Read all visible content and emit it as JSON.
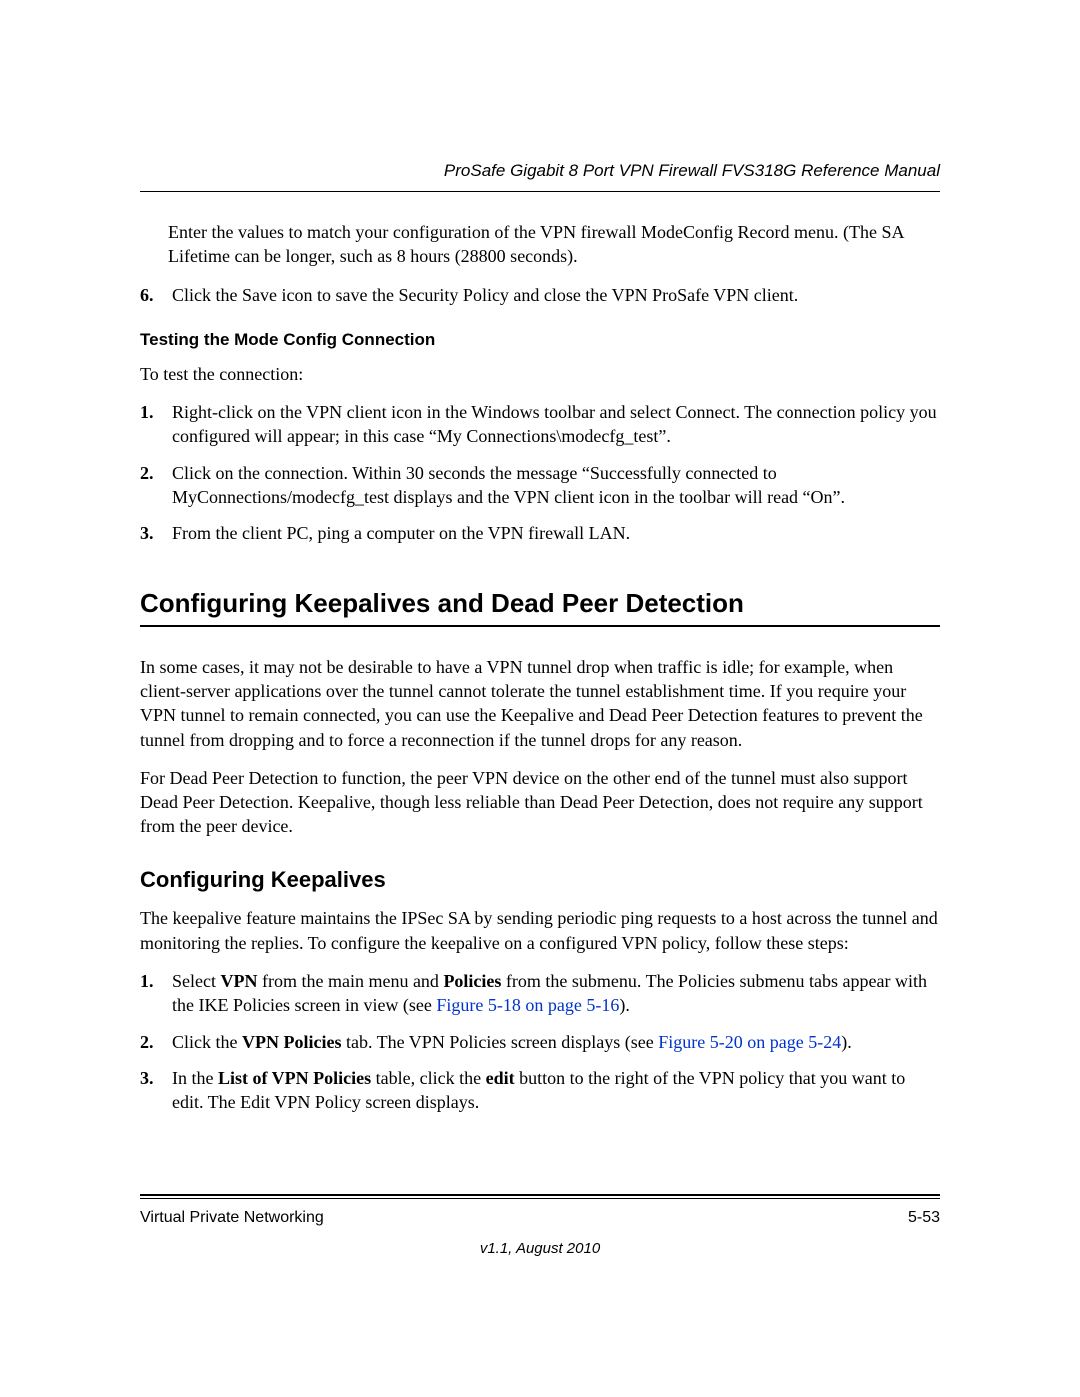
{
  "header": {
    "running_title": "ProSafe Gigabit 8 Port VPN Firewall FVS318G Reference Manual"
  },
  "intro_block": {
    "para": "Enter the values to match your configuration of the VPN firewall ModeConfig Record menu. (The SA Lifetime can be longer, such as 8 hours (28800 seconds)."
  },
  "step6": {
    "marker": "6.",
    "text": "Click the Save icon to save the Security Policy and close the VPN ProSafe VPN client."
  },
  "testing": {
    "title": "Testing the Mode Config Connection",
    "lead": "To test the connection:",
    "items": [
      {
        "marker": "1.",
        "text": "Right-click on the VPN client icon in the Windows toolbar and select Connect. The connection policy you configured will appear; in this case “My Connections\\modecfg_test”."
      },
      {
        "marker": "2.",
        "text": "Click on the connection. Within 30 seconds the message “Successfully connected to MyConnections/modecfg_test displays and the VPN client icon in the toolbar will read “On”."
      },
      {
        "marker": "3.",
        "text": "From the client PC, ping a computer on the VPN firewall LAN."
      }
    ]
  },
  "section": {
    "heading": "Configuring Keepalives and Dead Peer Detection",
    "para1": "In some cases, it may not be desirable to have a VPN tunnel drop when traffic is idle; for example, when client-server applications over the tunnel cannot tolerate the tunnel establishment time. If you require your VPN tunnel to remain connected, you can use the Keepalive and Dead Peer Detection features to prevent the tunnel from dropping and to force a reconnection if the tunnel drops for any reason.",
    "para2": "For Dead Peer Detection to function, the peer VPN device on the other end of the tunnel must also support Dead Peer Detection. Keepalive, though less reliable than Dead Peer Detection, does not require any support from the peer device."
  },
  "keepalives": {
    "heading": "Configuring Keepalives",
    "lead": "The keepalive feature maintains the IPSec SA by sending periodic ping requests to a host across the tunnel and monitoring the replies. To configure the keepalive on a configured VPN policy, follow these steps:",
    "items": [
      {
        "marker": "1.",
        "pre": "Select ",
        "bold1": "VPN",
        "mid1": " from the main menu and ",
        "bold2": "Policies",
        "post": " from the submenu. The Policies submenu tabs appear with the IKE Policies screen in view (see ",
        "link": "Figure 5-18 on page 5-16",
        "tail": ")."
      },
      {
        "marker": "2.",
        "pre": "Click the ",
        "bold1": "VPN Policies",
        "post": " tab. The VPN Policies screen displays (see ",
        "link": "Figure 5-20 on page 5-24",
        "tail": ")."
      },
      {
        "marker": "3.",
        "pre": "In the ",
        "bold1": "List of VPN Policies",
        "mid1": " table, click the ",
        "bold2": "edit",
        "post": " button to the right of the VPN policy that you want to edit. The Edit VPN Policy screen displays."
      }
    ]
  },
  "footer": {
    "chapter": "Virtual Private Networking",
    "page": "5-53",
    "version": "v1.1, August 2010"
  }
}
